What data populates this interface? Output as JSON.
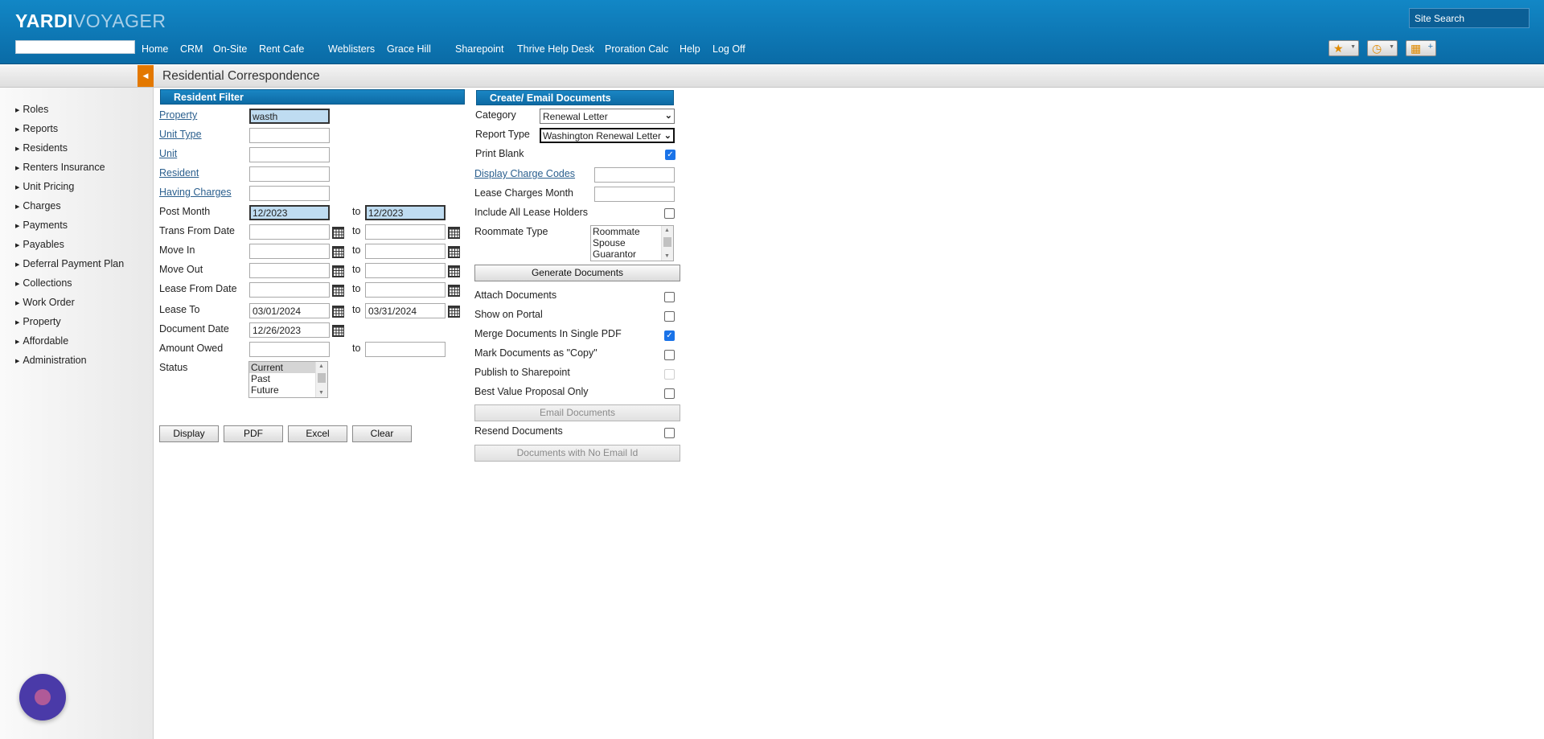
{
  "app": {
    "logo_primary": "YARDI",
    "logo_secondary": "VOYAGER"
  },
  "nav": [
    "Home",
    "CRM",
    "On-Site",
    "Rent Cafe",
    "Weblisters",
    "Grace Hill",
    "Sharepoint",
    "Thrive Help Desk",
    "Proration Calc",
    "Help",
    "Log Off"
  ],
  "search": {
    "placeholder": "Site Search"
  },
  "toolbar_icons": [
    "star-icon",
    "clock-icon",
    "dashboard-icon"
  ],
  "page_title": "Residential Correspondence",
  "sidebar": [
    "Roles",
    "Reports",
    "Residents",
    "Renters Insurance",
    "Unit Pricing",
    "Charges",
    "Payments",
    "Payables",
    "Deferral Payment Plan",
    "Collections",
    "Work Order",
    "Property",
    "Affordable",
    "Administration"
  ],
  "filter": {
    "header": "Resident Filter",
    "property_label": "Property",
    "property_value": "wasth",
    "unit_type_label": "Unit Type",
    "unit_label": "Unit",
    "resident_label": "Resident",
    "having_charges_label": "Having Charges",
    "post_month_label": "Post Month",
    "post_month_from": "12/2023",
    "post_month_to": "12/2023",
    "trans_from_label": "Trans From Date",
    "move_in_label": "Move In",
    "move_out_label": "Move Out",
    "lease_from_label": "Lease From Date",
    "lease_to_label": "Lease To",
    "lease_to_from": "03/01/2024",
    "lease_to_to": "03/31/2024",
    "document_date_label": "Document Date",
    "document_date_value": "12/26/2023",
    "amount_owed_label": "Amount Owed",
    "status_label": "Status",
    "status_options": [
      "Current",
      "Past",
      "Future"
    ],
    "to": "to",
    "display_btn": "Display",
    "pdf_btn": "PDF",
    "excel_btn": "Excel",
    "clear_btn": "Clear"
  },
  "create": {
    "header": "Create/ Email Documents",
    "category_label": "Category",
    "category_value": "Renewal Letter",
    "report_type_label": "Report Type",
    "report_type_value": "Washington Renewal Letter",
    "print_blank_label": "Print Blank",
    "print_blank": true,
    "display_charge_codes_label": "Display Charge Codes",
    "lease_charges_month_label": "Lease Charges Month",
    "include_all_label": "Include All Lease Holders",
    "include_all": false,
    "roommate_type_label": "Roommate Type",
    "roommate_options": [
      "Roommate",
      "Spouse",
      "Guarantor"
    ],
    "generate_btn": "Generate Documents",
    "attach_label": "Attach Documents",
    "attach": false,
    "portal_label": "Show on Portal",
    "portal": false,
    "merge_label": "Merge Documents In Single PDF",
    "merge": true,
    "copy_label": "Mark Documents as \"Copy\"",
    "copy": false,
    "sharepoint_label": "Publish to Sharepoint",
    "sharepoint": false,
    "best_value_label": "Best Value Proposal Only",
    "best_value": false,
    "email_btn": "Email Documents",
    "resend_label": "Resend Documents",
    "resend": false,
    "no_email_btn": "Documents with No Email Id"
  }
}
